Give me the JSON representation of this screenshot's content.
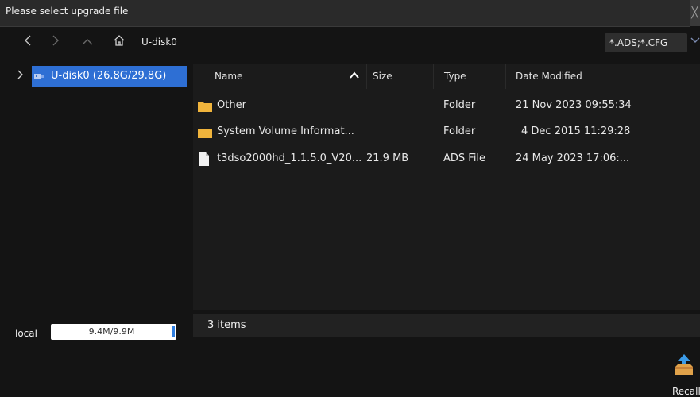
{
  "dialog": {
    "title": "Please select upgrade file"
  },
  "navbar": {
    "back_icon": "chevron-left-icon",
    "forward_icon": "chevron-right-icon",
    "up_icon": "chevron-up-icon",
    "home_icon": "home-icon",
    "path": "U-disk0",
    "filter": "*.ADS;*.CFG"
  },
  "tree": {
    "items": [
      {
        "label": "U-disk0  (26.8G/29.8G)",
        "selected": true
      }
    ]
  },
  "file_list": {
    "columns": [
      "Name",
      "Size",
      "Type",
      "Date Modified"
    ],
    "rows": [
      {
        "name": "Other",
        "size": "",
        "type": "Folder",
        "date": "21 Nov 2023 09:55:34",
        "icon": "folder-icon"
      },
      {
        "name": "System Volume Informat...",
        "size": "",
        "type": "Folder",
        "date": "4 Dec 2015 11:29:28",
        "icon": "folder-icon"
      },
      {
        "name": "t3dso2000hd_1.1.5.0_V20...",
        "size": "21.9 MB",
        "type": "ADS File",
        "date": "24 May 2023 17:06:...",
        "icon": "file-icon"
      }
    ]
  },
  "status": {
    "count": "3 items"
  },
  "local": {
    "label": "local",
    "usage": "9.4M/9.9M",
    "fraction": 0.95
  },
  "actions": {
    "recall": "Recall"
  },
  "colors": {
    "accent": "#2e6fd4",
    "folder": "#f0b43c",
    "background": "#141414"
  }
}
